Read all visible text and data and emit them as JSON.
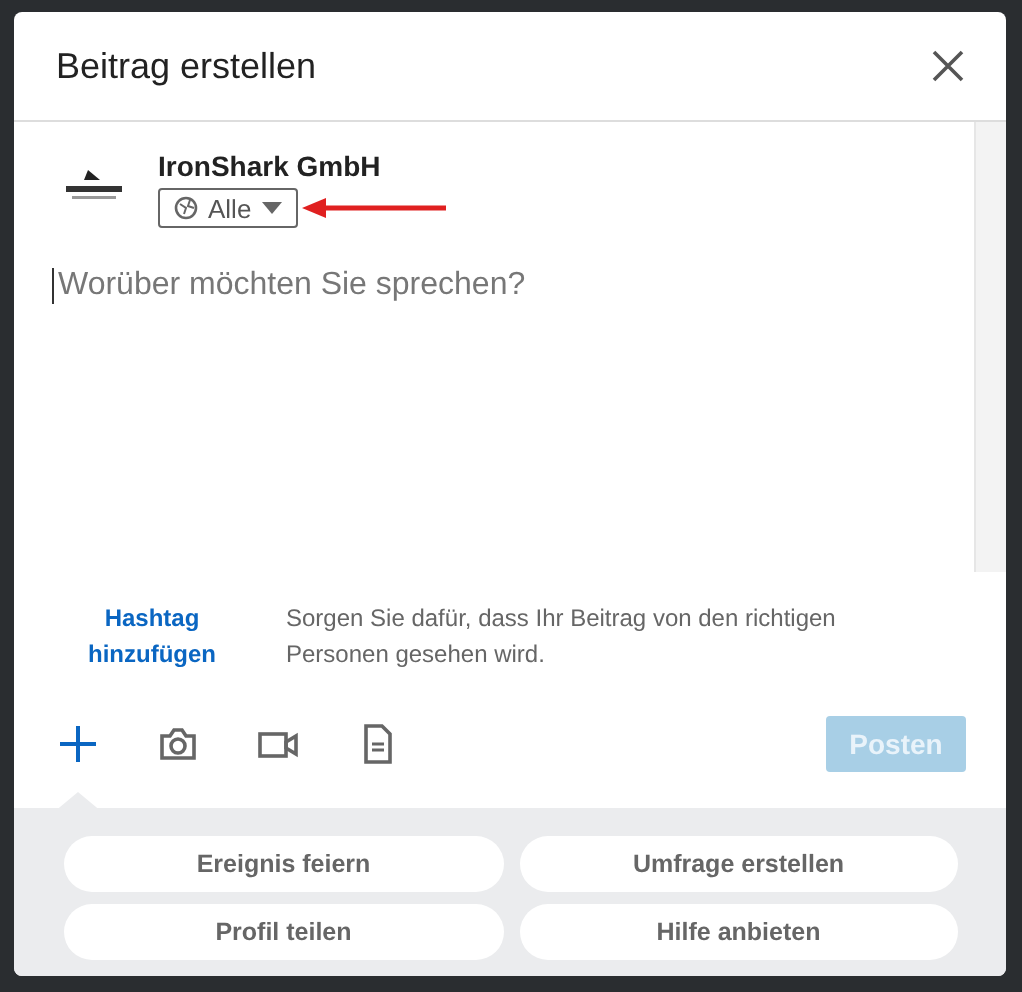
{
  "dialog": {
    "title": "Beitrag erstellen",
    "author": {
      "name": "IronShark GmbH",
      "visibility": "Alle"
    },
    "editor": {
      "placeholder": "Worüber möchten Sie sprechen?"
    },
    "hashtag": {
      "link": "Hashtag hinzufügen",
      "hint": "Sorgen Sie dafür, dass Ihr Beitrag von den richtigen Personen gesehen wird."
    },
    "toolbar": [
      {
        "kind": "plus",
        "selected": true
      },
      {
        "kind": "camera",
        "selected": false
      },
      {
        "kind": "video",
        "selected": false
      },
      {
        "kind": "document",
        "selected": false
      }
    ],
    "post_button": {
      "label": "Posten",
      "disabled": true
    },
    "suggestions": [
      "Ereignis feiern",
      "Umfrage erstellen",
      "Profil teilen",
      "Hilfe anbieten"
    ]
  }
}
